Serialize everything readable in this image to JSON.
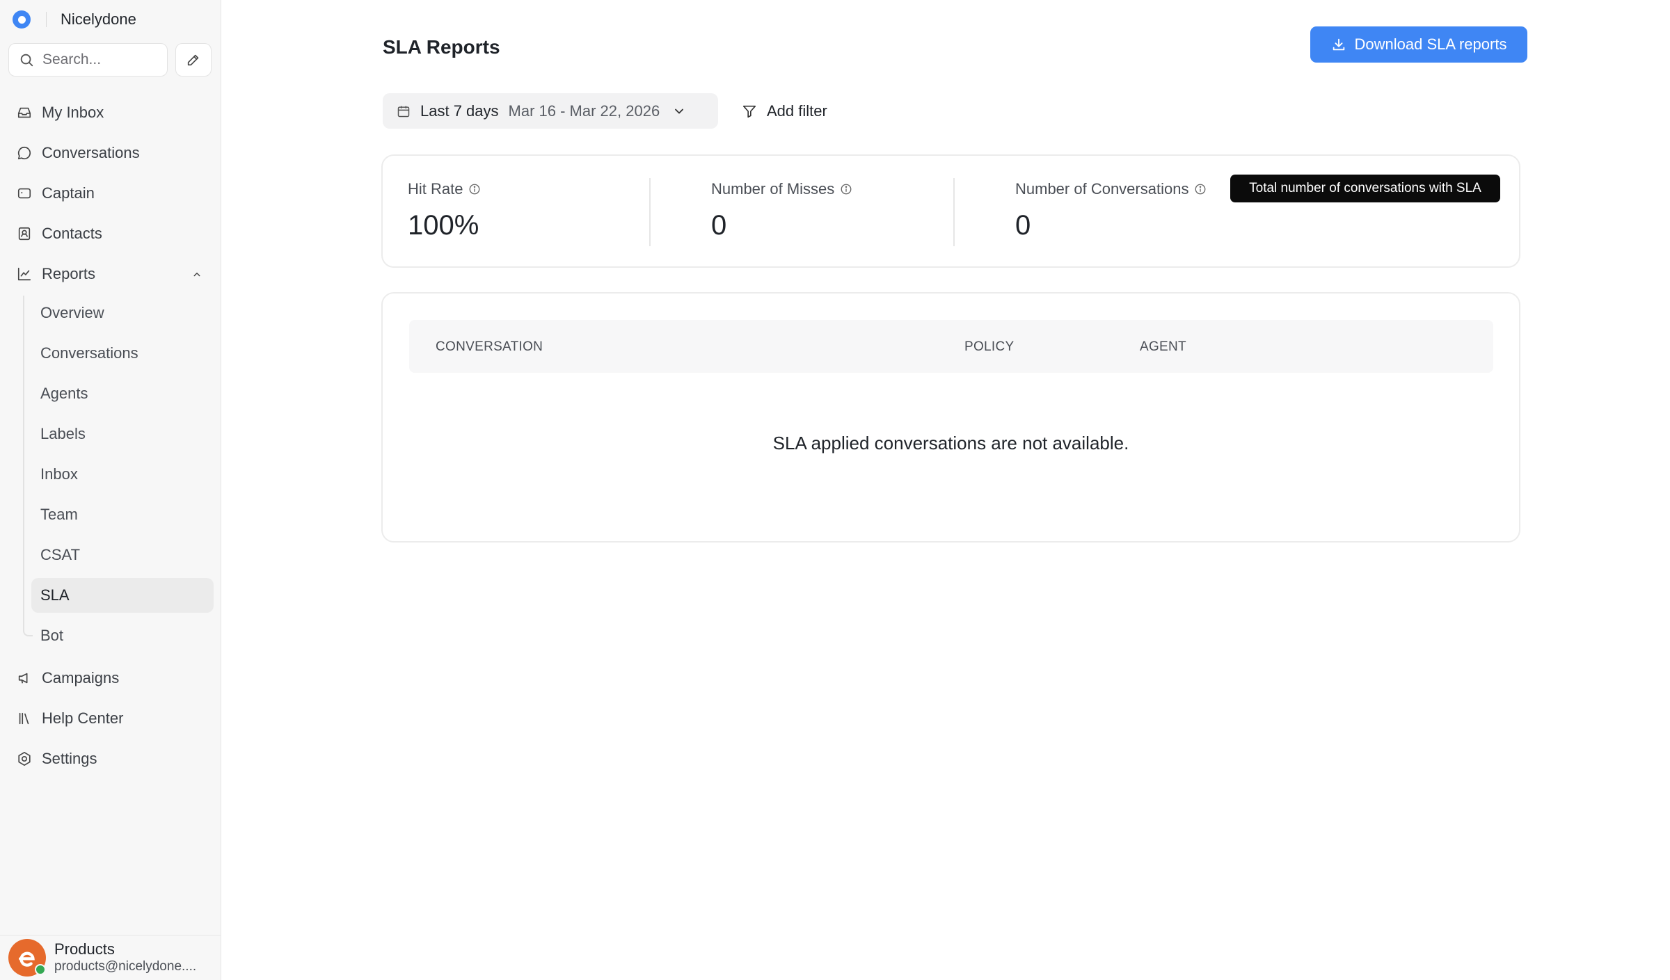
{
  "workspace": {
    "name": "Nicelydone"
  },
  "search": {
    "placeholder": "Search..."
  },
  "nav": {
    "my_inbox": "My Inbox",
    "conversations": "Conversations",
    "captain": "Captain",
    "contacts": "Contacts",
    "reports": "Reports",
    "campaigns": "Campaigns",
    "help_center": "Help Center",
    "settings": "Settings"
  },
  "reports_sub": [
    {
      "label": "Overview"
    },
    {
      "label": "Conversations"
    },
    {
      "label": "Agents"
    },
    {
      "label": "Labels"
    },
    {
      "label": "Inbox"
    },
    {
      "label": "Team"
    },
    {
      "label": "CSAT"
    },
    {
      "label": "SLA",
      "active": true
    },
    {
      "label": "Bot"
    }
  ],
  "user": {
    "name": "Products",
    "email": "products@nicelydone...."
  },
  "page": {
    "title": "SLA Reports",
    "download_label": "Download SLA reports"
  },
  "filters": {
    "date_label": "Last 7 days",
    "date_range": "Mar 16 - Mar 22, 2026",
    "add_filter": "Add filter"
  },
  "metrics": [
    {
      "label": "Hit Rate",
      "value": "100%"
    },
    {
      "label": "Number of Misses",
      "value": "0"
    },
    {
      "label": "Number of Conversations",
      "value": "0"
    }
  ],
  "tooltip": {
    "text": "Total number of conversations with SLA"
  },
  "table": {
    "columns": [
      "CONVERSATION",
      "POLICY",
      "AGENT"
    ],
    "empty_message": "SLA applied conversations are not available."
  },
  "colors": {
    "accent": "#3f86f4",
    "sidebar_bg": "#f7f7f7",
    "tooltip_bg": "#0b0b0b"
  }
}
